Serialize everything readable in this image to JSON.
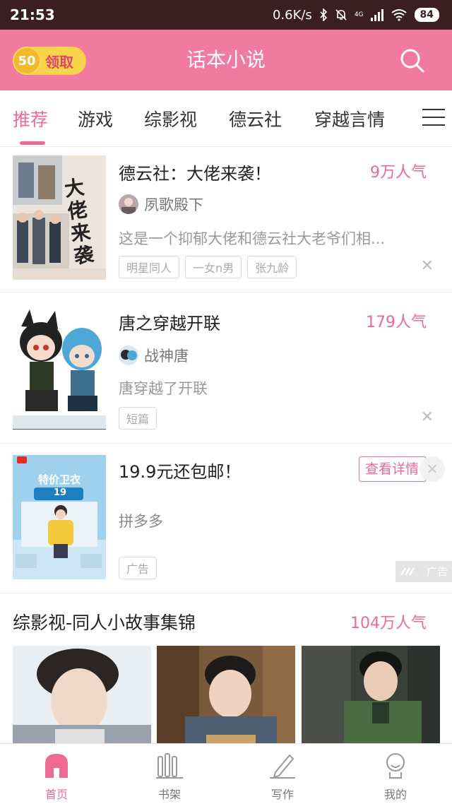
{
  "status_bar": {
    "time": "21:53",
    "speed": "0.6K/s",
    "network": "4G",
    "battery": "84"
  },
  "header": {
    "coin_amount": "50",
    "coin_label": "领取",
    "title": "话本小说"
  },
  "tabs": [
    {
      "label": "推荐",
      "active": true
    },
    {
      "label": "游戏"
    },
    {
      "label": "综影视"
    },
    {
      "label": "德云社"
    },
    {
      "label": "穿越言情"
    }
  ],
  "books": [
    {
      "title": "德云社：大佬来袭！",
      "popularity": "9万人气",
      "author": "夙歌殿下",
      "synopsis": "这是一个抑郁大佬和德云社大老爷们相...",
      "tags": [
        "明星同人",
        "一女n男",
        "张九龄"
      ],
      "cover_text": "大佬来袭"
    },
    {
      "title": "唐之穿越开联",
      "popularity": "179人气",
      "author": "战神唐",
      "synopsis": "唐穿越了开联",
      "tags": [
        "短篇"
      ]
    }
  ],
  "ad": {
    "title": "19.9元还包邮！",
    "detail_label": "查看详情",
    "merchant": "拼多多",
    "tag": "广告",
    "mark": "广告",
    "image_text": "特价卫衣",
    "image_price": "19"
  },
  "collection": {
    "title": "综影视-同人小故事集锦",
    "popularity": "104万人气"
  },
  "bottom_nav": [
    {
      "label": "首页",
      "active": true
    },
    {
      "label": "书架"
    },
    {
      "label": "写作"
    },
    {
      "label": "我的"
    }
  ],
  "colors": {
    "brand": "#f07aa0",
    "accent": "#ee6a92",
    "coin": "#f7d54a"
  }
}
